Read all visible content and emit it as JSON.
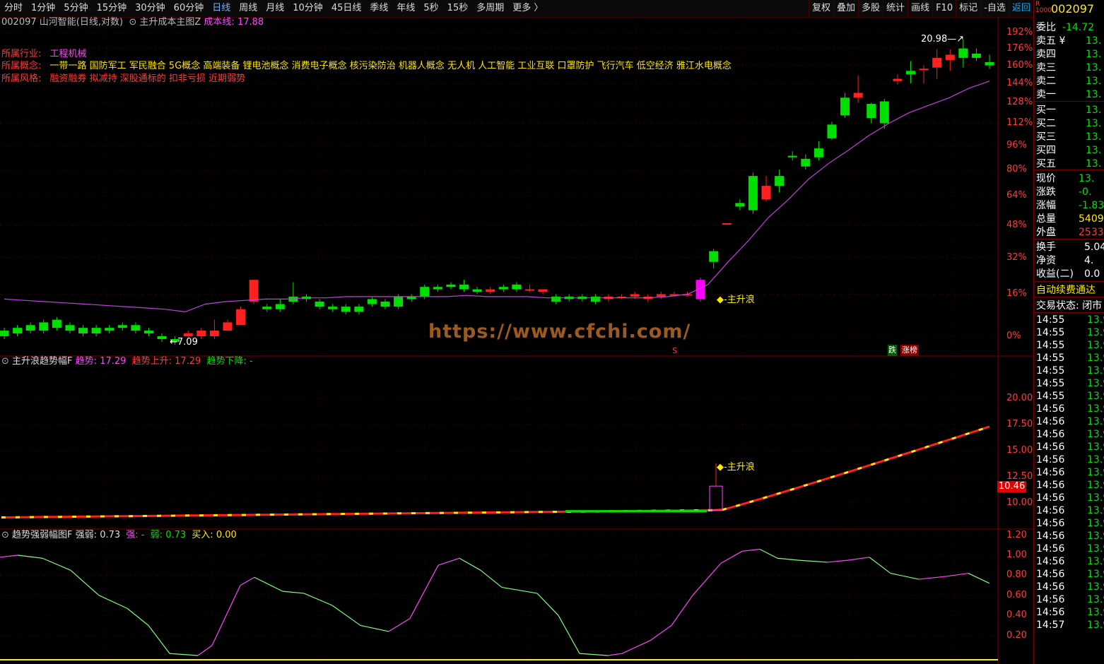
{
  "toolbar": {
    "periods": [
      "分时",
      "1分钟",
      "5分钟",
      "15分钟",
      "30分钟",
      "60分钟",
      "日线",
      "周线",
      "月线",
      "10分钟",
      "45日线",
      "季线",
      "年线",
      "5秒",
      "15秒",
      "多周期",
      "更多 〉"
    ],
    "right_buttons": [
      "复权",
      "叠加",
      "多股",
      "统计",
      "画线",
      "F10",
      "标记",
      "-自选",
      "返回"
    ]
  },
  "header": {
    "title": "002097 山河智能(日线,对数)",
    "indicator_name": "主升成本主图Z",
    "cost_label": "成本线:",
    "cost_value": "17.88"
  },
  "info": {
    "industry_label": "所属行业:",
    "industry_value": "工程机械",
    "concept_label": "所属概念:",
    "concept_value": "一带一路 国防军工 军民融合 5G概念 高端装备 锂电池概念 消费电子概念 核污染防治 机器人概念 无人机 人工智能 工业互联 口罩防护 飞行汽车 低空经济 雅江水电概念",
    "style_label": "所属风格:",
    "style_value": "融资融券 拟减持 深股通标的 扣非亏损 近期弱势"
  },
  "main_chart": {
    "axis_labels": [
      "192%",
      "176%",
      "160%",
      "144%",
      "128%",
      "112%",
      "96%",
      "80%",
      "64%",
      "48%",
      "32%",
      "16%",
      "0%"
    ],
    "high_marker": "20.98",
    "low_marker": "7.09",
    "signal_label": "主升浪",
    "s_marker": "S",
    "badge_die": "跌",
    "badge_zhang": "涨榜"
  },
  "panel2": {
    "name": "主升浪趋势幅F",
    "trend_label": "趋势:",
    "trend_value": "17.29",
    "up_label": "趋势上升:",
    "up_value": "17.29",
    "down_label": "趋势下降:",
    "down_value": "-",
    "axis_labels": [
      "20.00",
      "17.50",
      "15.00",
      "12.50",
      "10.00"
    ],
    "current_value": "10.46",
    "signal_label": "主升浪"
  },
  "panel3": {
    "name": "趋势强弱幅图F",
    "strength_label": "强弱:",
    "strength_value": "0.73",
    "strong_label": "强:",
    "strong_value": "-",
    "weak_label": "弱:",
    "weak_value": "0.73",
    "buy_label": "买入:",
    "buy_value": "0.00",
    "axis_labels": [
      "1.20",
      "1.00",
      "0.80",
      "0.60",
      "0.40",
      "0.20"
    ]
  },
  "side": {
    "code": "002097",
    "wb_label": "委比",
    "wb_value": "-14.72",
    "sell_labels": [
      "卖五 ¥",
      "卖四",
      "卖三",
      "卖二",
      "卖一"
    ],
    "sell_values": [
      "13.",
      "13.",
      "13.",
      "13.",
      "13."
    ],
    "buy_labels": [
      "买一",
      "买二",
      "买三",
      "买四",
      "买五"
    ],
    "buy_values": [
      "13.",
      "13.",
      "13.",
      "13.",
      "13."
    ],
    "stats": [
      {
        "label": "现价",
        "value": "13.",
        "color": "g"
      },
      {
        "label": "涨跌",
        "value": "-0.",
        "color": "g"
      },
      {
        "label": "涨幅",
        "value": "-1.83",
        "color": "g"
      },
      {
        "label": "总量",
        "value": "5409",
        "color": "y"
      },
      {
        "label": "外盘",
        "value": "2533",
        "color": "r"
      }
    ],
    "stats2": [
      {
        "label": "换手",
        "value": "5.04"
      },
      {
        "label": "净资",
        "value": "4."
      },
      {
        "label": "收益(二)",
        "value": "0.0"
      }
    ],
    "notice": "自动续费通达",
    "trade_status_label": "交易状态:",
    "trade_status_value": "闭市",
    "ticks_time": [
      "14:55",
      "14:55",
      "14:55",
      "14:55",
      "14:55",
      "14:55",
      "14:55",
      "14:56",
      "14:56",
      "14:56",
      "14:56",
      "14:56",
      "14:56",
      "14:56",
      "14:56",
      "14:56",
      "14:56",
      "14:56",
      "14:56",
      "14:56",
      "14:56",
      "14:56",
      "14:56",
      "14:56",
      "14:57"
    ],
    "ticks_price": "13.9"
  },
  "watermark": "https://www.cfchi.com/",
  "colors": {
    "up": "#ff2020",
    "down": "#00e000",
    "ma": "#c040e0",
    "axis": "#7a0000",
    "yellow": "#ffea00",
    "magenta": "#ff00ff"
  },
  "chart_data": {
    "type": "candlestick",
    "title": "002097 山河智能(日线,对数)",
    "y_axis": "percent change",
    "y_ticks": [
      "0%",
      "16%",
      "32%",
      "48%",
      "64%",
      "80%",
      "96%",
      "112%",
      "128%",
      "144%",
      "160%",
      "176%",
      "192%"
    ],
    "candles": [
      {
        "o": 2,
        "c": 0,
        "h": 3,
        "l": -1
      },
      {
        "o": 3,
        "c": 1,
        "h": 4,
        "l": 0
      },
      {
        "o": 4,
        "c": 2,
        "h": 5,
        "l": 1
      },
      {
        "o": 5,
        "c": 2,
        "h": 6,
        "l": 1
      },
      {
        "o": 6,
        "c": 3,
        "h": 7,
        "l": 2
      },
      {
        "o": 4,
        "c": 2,
        "h": 5,
        "l": 1
      },
      {
        "o": 3,
        "c": 1,
        "h": 4,
        "l": 0
      },
      {
        "o": 3,
        "c": 1,
        "h": 4,
        "l": 0
      },
      {
        "o": 3,
        "c": 2,
        "h": 4,
        "l": 1
      },
      {
        "o": 4,
        "c": 3,
        "h": 5,
        "l": 2
      },
      {
        "o": 4,
        "c": 2,
        "h": 5,
        "l": 1
      },
      {
        "o": 2,
        "c": 1,
        "h": 3,
        "l": 0
      },
      {
        "o": 0,
        "c": -1,
        "h": 1,
        "l": -2
      },
      {
        "o": -1,
        "c": -2,
        "h": 0,
        "l": -3
      },
      {
        "o": 0,
        "c": 1,
        "h": 2,
        "l": -1
      },
      {
        "o": 0,
        "c": 2,
        "h": 3,
        "l": -1
      },
      {
        "o": 0,
        "c": 2,
        "h": 6,
        "l": -1
      },
      {
        "o": 2,
        "c": 5,
        "h": 6,
        "l": 2
      },
      {
        "o": 4,
        "c": 10,
        "h": 11,
        "l": 4
      },
      {
        "o": 13,
        "c": 22,
        "h": 22,
        "l": 12
      },
      {
        "o": 11,
        "c": 10,
        "h": 12,
        "l": 9
      },
      {
        "o": 12,
        "c": 10,
        "h": 14,
        "l": 9
      },
      {
        "o": 15,
        "c": 13,
        "h": 21,
        "l": 12
      },
      {
        "o": 15,
        "c": 14,
        "h": 16,
        "l": 13
      },
      {
        "o": 13,
        "c": 11,
        "h": 14,
        "l": 10
      },
      {
        "o": 11,
        "c": 10,
        "h": 12,
        "l": 9
      },
      {
        "o": 11,
        "c": 9,
        "h": 12,
        "l": 8
      },
      {
        "o": 11,
        "c": 9,
        "h": 12,
        "l": 8
      },
      {
        "o": 14,
        "c": 12,
        "h": 15,
        "l": 11
      },
      {
        "o": 13,
        "c": 11,
        "h": 14,
        "l": 10
      },
      {
        "o": 15,
        "c": 11,
        "h": 16,
        "l": 10
      },
      {
        "o": 15,
        "c": 14,
        "h": 16,
        "l": 13
      },
      {
        "o": 19,
        "c": 15,
        "h": 20,
        "l": 14
      },
      {
        "o": 19,
        "c": 18,
        "h": 20,
        "l": 17
      },
      {
        "o": 20,
        "c": 19,
        "h": 21,
        "l": 18
      },
      {
        "o": 20,
        "c": 18,
        "h": 22,
        "l": 17
      },
      {
        "o": 18,
        "c": 17,
        "h": 19,
        "l": 16
      },
      {
        "o": 17,
        "c": 18,
        "h": 19,
        "l": 16
      },
      {
        "o": 19,
        "c": 18,
        "h": 20,
        "l": 17
      },
      {
        "o": 20,
        "c": 18,
        "h": 21,
        "l": 17
      },
      {
        "o": 18,
        "c": 18,
        "h": 20,
        "l": 17
      },
      {
        "o": 17,
        "c": 18,
        "h": 18,
        "l": 16
      },
      {
        "o": 15,
        "c": 13,
        "h": 16,
        "l": 12
      },
      {
        "o": 15,
        "c": 14,
        "h": 16,
        "l": 13
      },
      {
        "o": 15,
        "c": 14,
        "h": 16,
        "l": 13
      },
      {
        "o": 15,
        "c": 13,
        "h": 16,
        "l": 12
      },
      {
        "o": 14,
        "c": 15,
        "h": 16,
        "l": 13
      },
      {
        "o": 15,
        "c": 15,
        "h": 16,
        "l": 14
      },
      {
        "o": 15,
        "c": 16,
        "h": 17,
        "l": 14
      },
      {
        "o": 14,
        "c": 15,
        "h": 16,
        "l": 13
      },
      {
        "o": 15,
        "c": 16,
        "h": 17,
        "l": 14
      },
      {
        "o": 16,
        "c": 16,
        "h": 17,
        "l": 15
      },
      {
        "o": 16,
        "c": 16,
        "h": 17,
        "l": 15
      },
      {
        "o": 22,
        "c": 14,
        "h": 23,
        "l": 13
      },
      {
        "o": 35,
        "c": 30,
        "h": 36,
        "l": 27
      },
      {
        "o": 49,
        "c": 49,
        "h": 49,
        "l": 49
      },
      {
        "o": 60,
        "c": 58,
        "h": 62,
        "l": 56
      },
      {
        "o": 76,
        "c": 56,
        "h": 78,
        "l": 54
      },
      {
        "o": 62,
        "c": 70,
        "h": 76,
        "l": 61
      },
      {
        "o": 76,
        "c": 70,
        "h": 80,
        "l": 66
      },
      {
        "o": 89,
        "c": 88,
        "h": 92,
        "l": 86
      },
      {
        "o": 87,
        "c": 82,
        "h": 90,
        "l": 80
      },
      {
        "o": 94,
        "c": 88,
        "h": 99,
        "l": 86
      },
      {
        "o": 111,
        "c": 101,
        "h": 113,
        "l": 100
      },
      {
        "o": 132,
        "c": 118,
        "h": 136,
        "l": 116
      },
      {
        "o": 132,
        "c": 136,
        "h": 151,
        "l": 128
      },
      {
        "o": 127,
        "c": 116,
        "h": 128,
        "l": 112
      },
      {
        "o": 129,
        "c": 112,
        "h": 131,
        "l": 108
      },
      {
        "o": 146,
        "c": 148,
        "h": 152,
        "l": 143
      },
      {
        "o": 155,
        "c": 152,
        "h": 164,
        "l": 144
      },
      {
        "o": 157,
        "c": 157,
        "h": 160,
        "l": 144
      },
      {
        "o": 158,
        "c": 167,
        "h": 175,
        "l": 148
      },
      {
        "o": 165,
        "c": 170,
        "h": 175,
        "l": 155
      },
      {
        "o": 176,
        "c": 167,
        "h": 185,
        "l": 158
      },
      {
        "o": 171,
        "c": 167,
        "h": 176,
        "l": 164
      },
      {
        "o": 163,
        "c": 160,
        "h": 170,
        "l": 157
      }
    ],
    "ma_line": [
      14,
      13.5,
      13,
      12.5,
      12,
      11.5,
      11,
      10.5,
      10,
      9,
      12,
      13,
      13.5,
      14,
      14,
      14.5,
      14.5,
      15,
      15,
      15,
      15,
      15,
      15,
      15.5,
      15,
      15,
      15,
      14.5,
      14.5,
      14.5,
      14.5,
      14.5,
      14.5,
      15,
      16,
      20,
      30,
      40,
      52,
      62,
      74,
      84,
      93,
      103,
      112,
      120,
      126,
      132,
      140,
      146
    ]
  }
}
